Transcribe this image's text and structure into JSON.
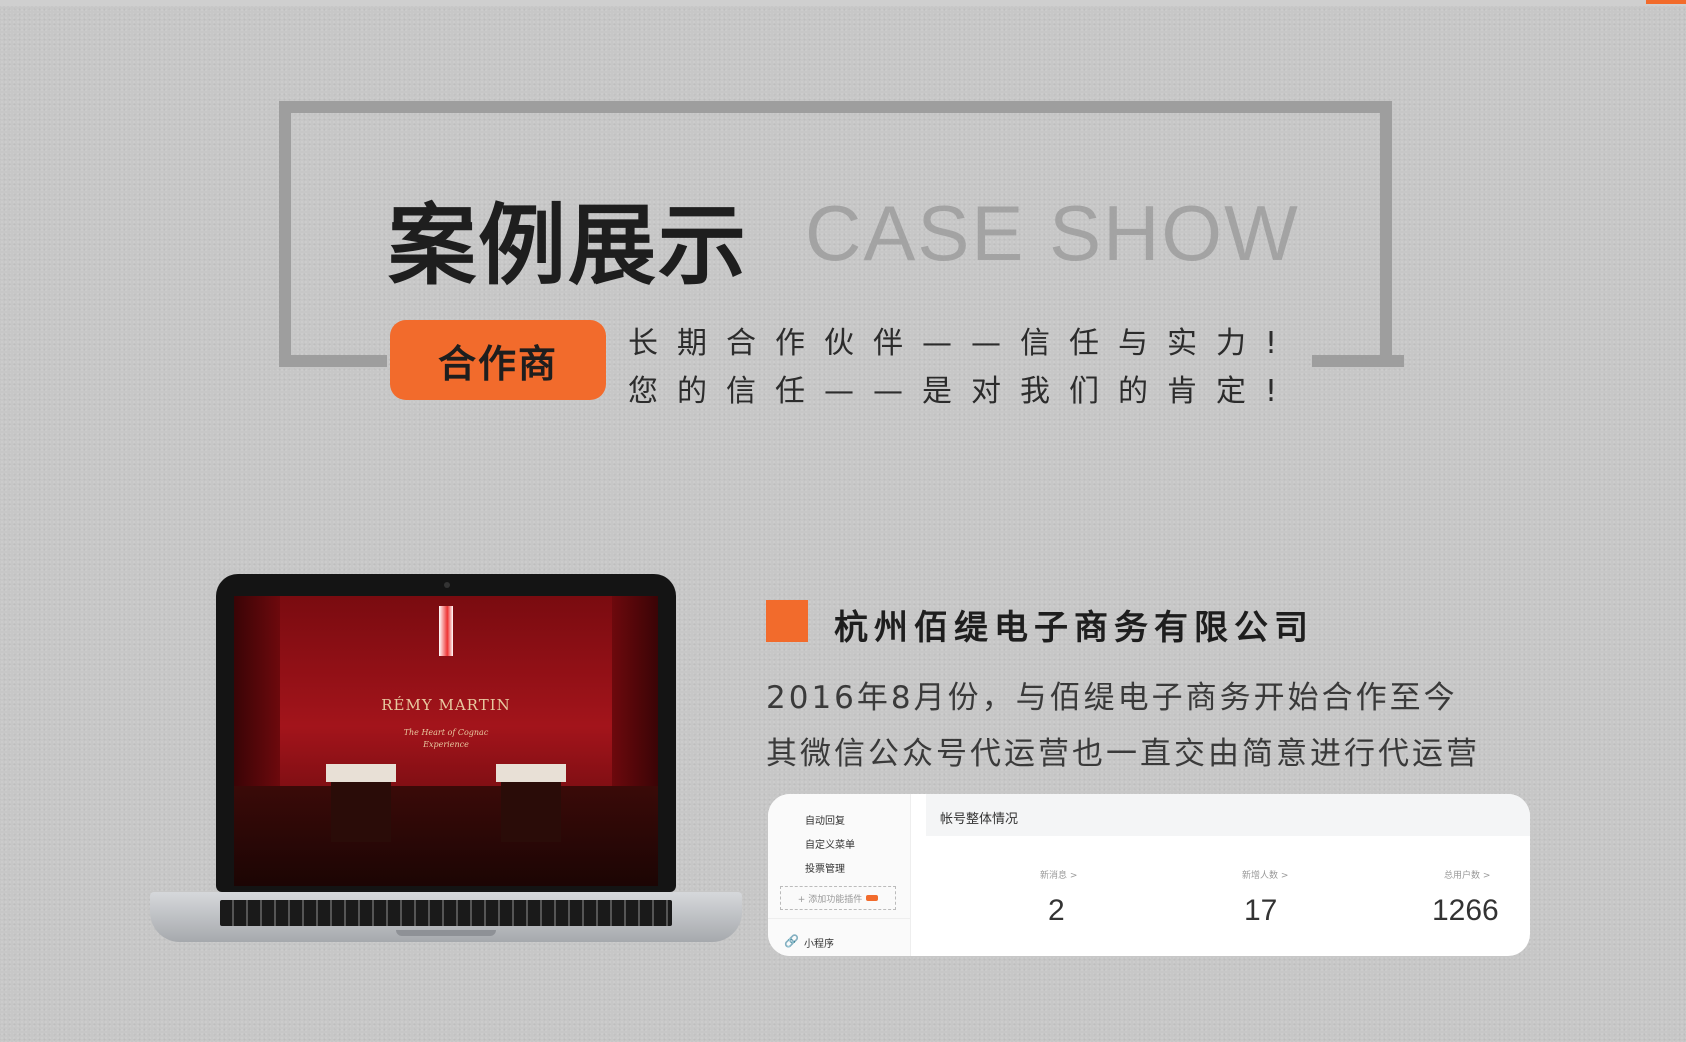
{
  "header": {
    "title_cn": "案例展示",
    "title_en": "CASE SHOW",
    "badge": "合作商",
    "slogan_line1": "长期合作伙伴——信任与实力!",
    "slogan_line2": "您的信任——是对我们的肯定!"
  },
  "laptop_screen": {
    "brand": "RÉMY MARTIN",
    "tagline_1": "The Heart of Cognac",
    "tagline_2": "Experience"
  },
  "company": {
    "name": "杭州佰缇电子商务有限公司",
    "desc_line1": "2016年8月份，与佰缇电子商务开始合作至今",
    "desc_line2": "其微信公众号代运营也一直交由简意进行代运营"
  },
  "dashboard": {
    "sidebar_items": [
      "自动回复",
      "自定义菜单",
      "投票管理"
    ],
    "add_plugin": "+ 添加功能插件",
    "mini_program": "小程序",
    "title": "帐号整体情况",
    "stats": [
      {
        "label": "新消息 >",
        "value": "2"
      },
      {
        "label": "新增人数 >",
        "value": "17"
      },
      {
        "label": "总用户数 >",
        "value": "1266"
      }
    ]
  },
  "colors": {
    "accent": "#f26b2c",
    "frame": "#9e9e9e",
    "background": "#c7c7c7"
  }
}
